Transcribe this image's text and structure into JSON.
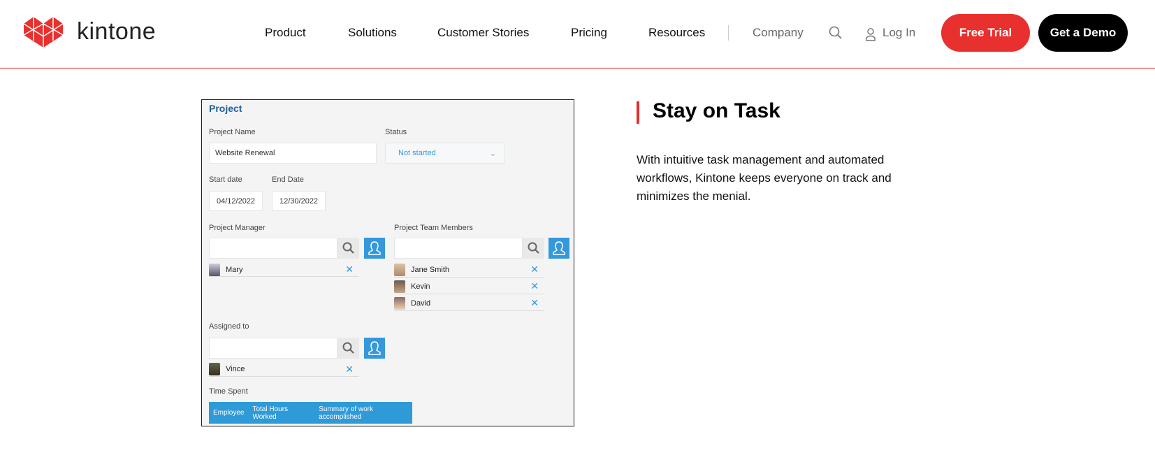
{
  "header": {
    "brand": "kintone",
    "nav": [
      "Product",
      "Solutions",
      "Customer Stories",
      "Pricing",
      "Resources"
    ],
    "company": "Company",
    "login": "Log In",
    "free_trial": "Free Trial",
    "demo": "Get a Demo",
    "colors": {
      "accent": "#e8302e",
      "demo": "#000000"
    }
  },
  "form": {
    "title": "Project",
    "project_name_label": "Project Name",
    "project_name_value": "Website Renewal",
    "status_label": "Status",
    "status_value": "Not started",
    "start_label": "Start date",
    "start_value": "04/12/2022",
    "end_label": "End Date",
    "end_value": "12/30/2022",
    "manager_label": "Project Manager",
    "manager": [
      "Mary"
    ],
    "team_label": "Project Team Members",
    "team": [
      "Jane Smith",
      "Kevin",
      "David"
    ],
    "assigned_label": "Assigned to",
    "assigned": [
      "Vince"
    ],
    "time_label": "Time Spent",
    "time_columns": [
      "Employee",
      "Total Hours Worked",
      "Summary of work accomplished"
    ]
  },
  "feature": {
    "heading": "Stay on Task",
    "body": "With intuitive task management and automated workflows, Kintone keeps everyone on track and minimizes the menial."
  }
}
